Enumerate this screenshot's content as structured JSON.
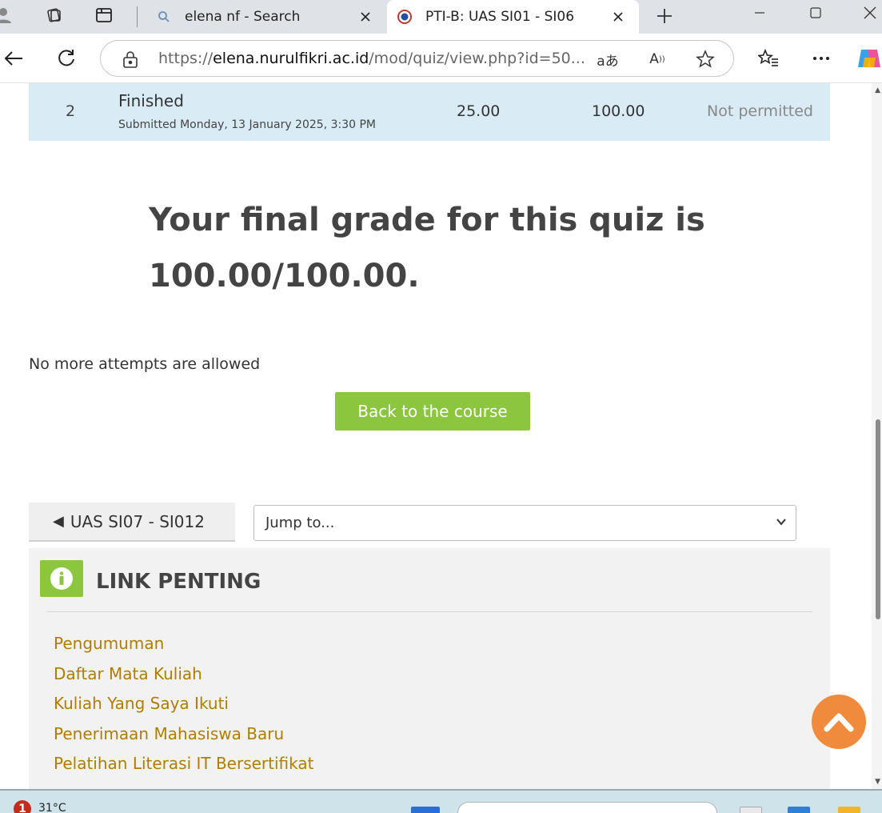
{
  "browser": {
    "tabs": [
      {
        "title": "elena nf - Search",
        "active": false,
        "favicon": "search-icon"
      },
      {
        "title": "PTI-B: UAS SI01 - SI06",
        "active": true,
        "favicon": "site-logo-icon"
      }
    ],
    "url_prefix": "https://",
    "url_host": "elena.nurulfikri.ac.id",
    "url_path": "/mod/quiz/view.php?id=50...",
    "read_aloud_label": "A",
    "translate_label": "aあ"
  },
  "attempt": {
    "number": "2",
    "state": "Finished",
    "submitted": "Submitted Monday, 13 January 2025, 3:30 PM",
    "marks": "25.00",
    "grade": "100.00",
    "review": "Not permitted"
  },
  "final_grade_text": "Your final grade for this quiz is 100.00/100.00.",
  "no_more_attempts": "No more attempts are allowed",
  "back_button_label": "Back to the course",
  "nav": {
    "prev_arrow": "◀",
    "prev_label": "UAS SI07 - SI012",
    "jump_placeholder": "Jump to..."
  },
  "block": {
    "title": "LINK PENTING",
    "icon": "info-icon",
    "links": [
      "Pengumuman",
      "Daftar Mata Kuliah",
      "Kuliah Yang Saya Ikuti",
      "Penerimaan Mahasiswa Baru",
      "Pelatihan Literasi IT Bersertifikat"
    ]
  },
  "taskbar": {
    "weather_badge": "1",
    "temperature": "31°C"
  },
  "colors": {
    "accent_green": "#8cc63f",
    "link_gold": "#b07d00",
    "to_top_orange": "#f08a3c",
    "attempt_row_bg": "#d9ebf5"
  }
}
